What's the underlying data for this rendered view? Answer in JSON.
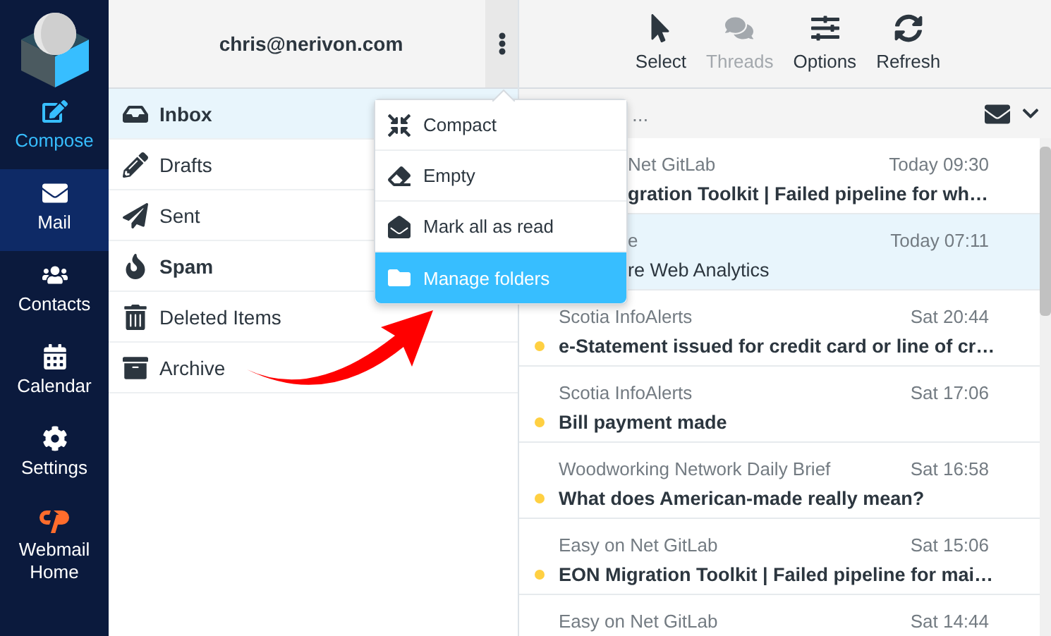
{
  "nav": [
    {
      "label": "Compose",
      "kind": "compose",
      "selected": false
    },
    {
      "label": "Mail",
      "kind": "mail",
      "selected": true
    },
    {
      "label": "Contacts",
      "kind": "contacts",
      "selected": false
    },
    {
      "label": "Calendar",
      "kind": "calendar",
      "selected": false
    },
    {
      "label": "Settings",
      "kind": "settings",
      "selected": false
    },
    {
      "label": "Webmail Home",
      "kind": "home",
      "selected": false
    }
  ],
  "account": {
    "email": "chris@nerivon.com"
  },
  "folders": [
    {
      "label": "Inbox",
      "kind": "inbox",
      "selected": true,
      "unread": true
    },
    {
      "label": "Drafts",
      "kind": "drafts",
      "selected": false,
      "unread": false
    },
    {
      "label": "Sent",
      "kind": "sent",
      "selected": false,
      "unread": false
    },
    {
      "label": "Spam",
      "kind": "spam",
      "selected": false,
      "unread": true
    },
    {
      "label": "Deleted Items",
      "kind": "trash",
      "selected": false,
      "unread": false
    },
    {
      "label": "Archive",
      "kind": "archive",
      "selected": false,
      "unread": false
    }
  ],
  "folder_menu": [
    {
      "label": "Compact",
      "kind": "compact",
      "selected": false
    },
    {
      "label": "Empty",
      "kind": "empty",
      "selected": false
    },
    {
      "label": "Mark all as read",
      "kind": "markread",
      "selected": false
    },
    {
      "label": "Manage folders",
      "kind": "manage",
      "selected": true
    }
  ],
  "toolbar": [
    {
      "label": "Select",
      "kind": "select",
      "disabled": false
    },
    {
      "label": "Threads",
      "kind": "threads",
      "disabled": true
    },
    {
      "label": "Options",
      "kind": "options",
      "disabled": false
    },
    {
      "label": "Refresh",
      "kind": "refresh",
      "disabled": false
    }
  ],
  "search": {
    "placeholder": "..."
  },
  "messages": [
    {
      "sender": "Net GitLab",
      "date": "Today 09:30",
      "subject": "gration Toolkit | Failed pipeline for wh…",
      "unread": true,
      "selected": false
    },
    {
      "sender": "e",
      "date": "Today 07:11",
      "subject": "re Web Analytics",
      "unread": false,
      "selected": true
    },
    {
      "sender": "Scotia InfoAlerts",
      "date": "Sat 20:44",
      "subject": "e-Statement issued for credit card or line of cr…",
      "unread": true,
      "selected": false
    },
    {
      "sender": "Scotia InfoAlerts",
      "date": "Sat 17:06",
      "subject": "Bill payment made",
      "unread": true,
      "selected": false
    },
    {
      "sender": "Woodworking Network Daily Brief",
      "date": "Sat 16:58",
      "subject": "What does American-made really mean?",
      "unread": true,
      "selected": false
    },
    {
      "sender": "Easy on Net GitLab",
      "date": "Sat 15:06",
      "subject": "EON Migration Toolkit | Failed pipeline for mai…",
      "unread": true,
      "selected": false
    },
    {
      "sender": "Easy on Net GitLab",
      "date": "Sat 14:44",
      "selected": false
    }
  ]
}
